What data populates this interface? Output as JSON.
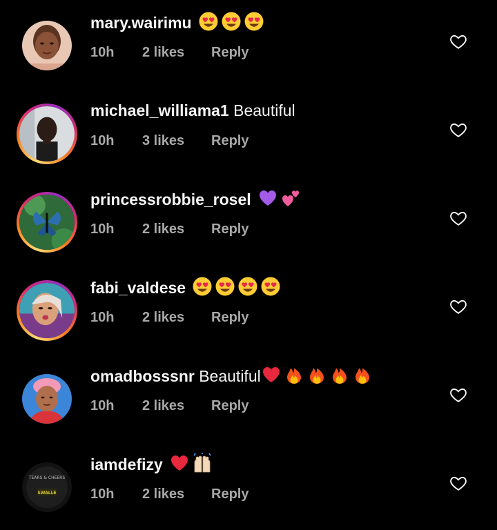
{
  "comments": [
    {
      "username": "mary.wairimu",
      "text": "",
      "emojis": [
        "heart-eyes",
        "heart-eyes",
        "heart-eyes"
      ],
      "time": "10h",
      "likes": "2 likes",
      "reply": "Reply",
      "story_ring": false
    },
    {
      "username": "michael_williama1",
      "text": "Beautiful",
      "emojis": [],
      "time": "10h",
      "likes": "3 likes",
      "reply": "Reply",
      "story_ring": true
    },
    {
      "username": "princessrobbie_rosel",
      "text": "",
      "emojis": [
        "purple-heart",
        "two-hearts"
      ],
      "time": "10h",
      "likes": "2 likes",
      "reply": "Reply",
      "story_ring": true
    },
    {
      "username": "fabi_valdese",
      "text": "",
      "emojis": [
        "heart-eyes",
        "heart-eyes",
        "heart-eyes",
        "heart-eyes"
      ],
      "time": "10h",
      "likes": "2 likes",
      "reply": "Reply",
      "story_ring": true
    },
    {
      "username": "omadbosssnr",
      "text": "Beautiful",
      "emojis": [
        "red-heart",
        "fire",
        "fire",
        "fire",
        "fire"
      ],
      "time": "10h",
      "likes": "2 likes",
      "reply": "Reply",
      "story_ring": false
    },
    {
      "username": "iamdefizy",
      "text": "",
      "emojis": [
        "red-heart",
        "raising-hands"
      ],
      "time": "10h",
      "likes": "2 likes",
      "reply": "Reply",
      "story_ring": false,
      "avatar_text": [
        "TEARS & CHEERS",
        "SWALLE"
      ]
    }
  ],
  "colors": {
    "background": "#000000",
    "primary_text": "#f5f5f5",
    "secondary_text": "#a8a8a8"
  }
}
